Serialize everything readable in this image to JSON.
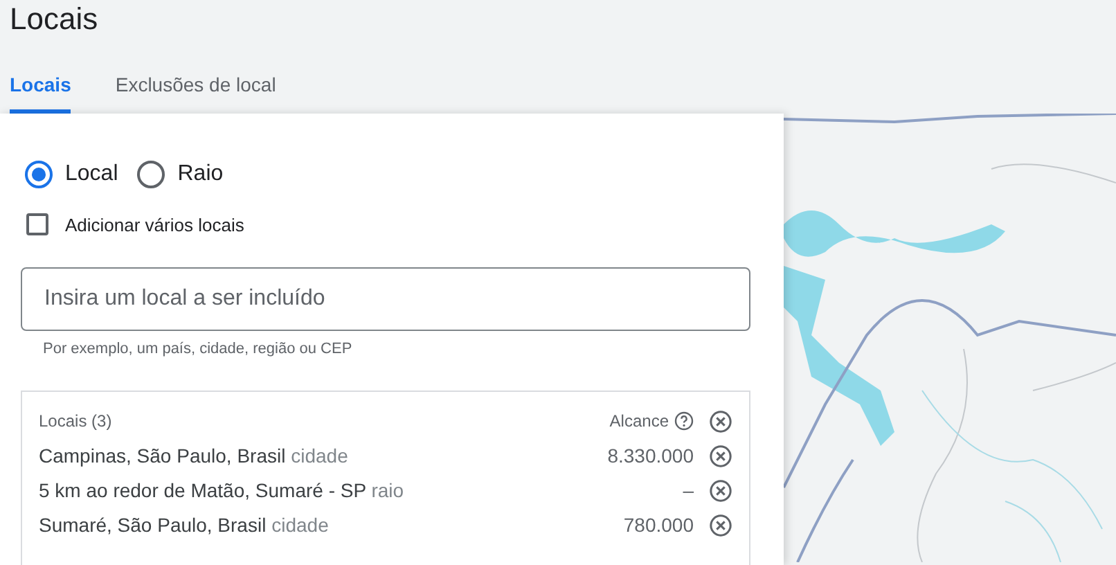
{
  "page_title": "Locais",
  "tabs": [
    {
      "label": "Locais",
      "selected": true
    },
    {
      "label": "Exclusões de local",
      "selected": false
    }
  ],
  "target_mode": [
    {
      "label": "Local",
      "selected": true
    },
    {
      "label": "Raio",
      "selected": false
    }
  ],
  "multiple_locations": {
    "label": "Adicionar vários locais",
    "checked": false
  },
  "location_input": {
    "placeholder": "Insira um local a ser incluído",
    "hint": "Por exemplo, um país, cidade, região ou CEP"
  },
  "locations": {
    "title": "Locais (3)",
    "reach_header": "Alcance",
    "rows": [
      {
        "name": "Campinas, São Paulo, Brasil",
        "type": "cidade",
        "reach": "8.330.000"
      },
      {
        "name": "5 km ao redor de Matão, Sumaré - SP",
        "type": "raio",
        "reach": "–"
      },
      {
        "name": "Sumaré, São Paulo, Brasil",
        "type": "cidade",
        "reach": "780.000"
      }
    ]
  }
}
